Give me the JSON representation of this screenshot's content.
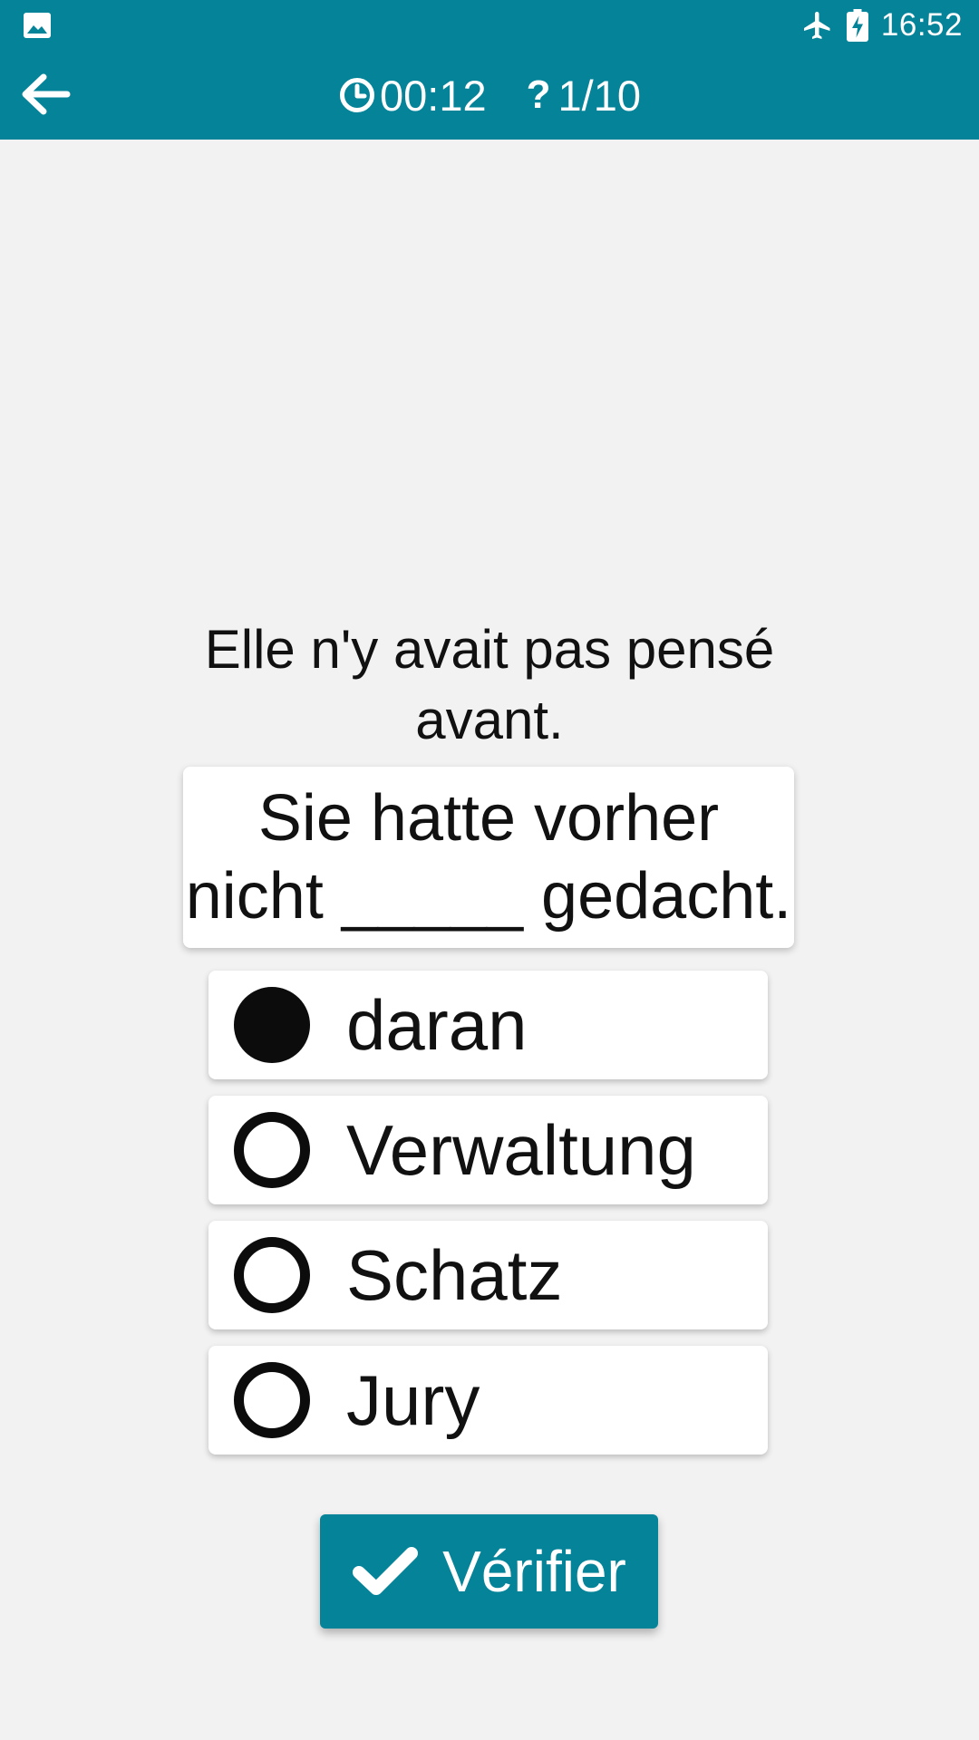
{
  "status_bar": {
    "time": "16:52",
    "icons": [
      "gallery-icon",
      "airplane-mode-icon",
      "battery-charging-icon"
    ]
  },
  "app_bar": {
    "back_icon": "arrow-left-icon",
    "timer": {
      "icon": "clock-icon",
      "value": "00:12"
    },
    "progress": {
      "icon": "question-mark-icon",
      "value": "1/10"
    }
  },
  "quiz": {
    "prompt": "Elle n'y avait pas pensé avant.",
    "sentence": "Sie hatte vorher nicht _____ gedacht.",
    "options": [
      {
        "label": "daran",
        "selected": true
      },
      {
        "label": "Verwaltung",
        "selected": false
      },
      {
        "label": "Schatz",
        "selected": false
      },
      {
        "label": "Jury",
        "selected": false
      }
    ]
  },
  "verify_button": {
    "icon": "checkmark-icon",
    "label": "Vérifier"
  },
  "colors": {
    "accent": "#048399",
    "background": "#f2f2f2",
    "card": "#ffffff",
    "text": "#111111"
  }
}
